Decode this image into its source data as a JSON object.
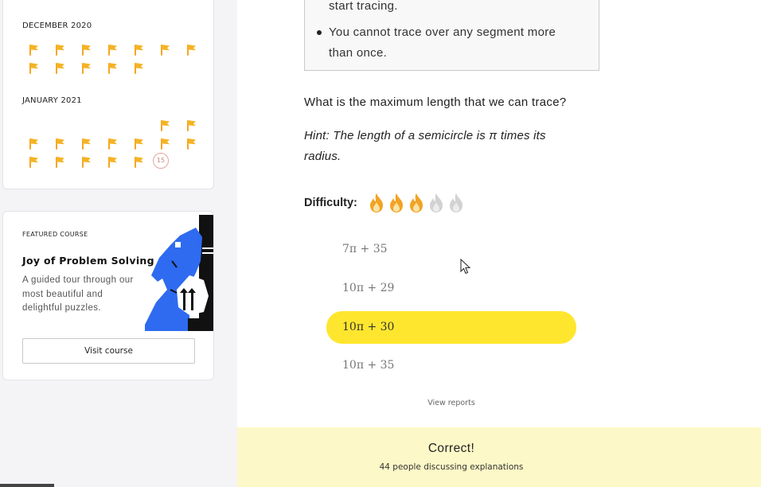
{
  "streaks": {
    "months": [
      {
        "label": "DECEMBER 2020"
      },
      {
        "label": "JANUARY 2021"
      }
    ],
    "today_day": "15",
    "flag_color": "#f5b324"
  },
  "featured_course": {
    "label": "FEATURED COURSE",
    "title": "Joy of Problem Solving",
    "description": "A guided tour through our most beautiful and delightful puzzles.",
    "button_label": "Visit course",
    "art_icon": "chess-knight-art"
  },
  "problem": {
    "rules": [
      "start tracing.",
      "You cannot trace over any segment more",
      "than once."
    ],
    "question": "What is the maximum length that we can trace?",
    "hint": "Hint: The length of a semicircle is π times its radius.",
    "difficulty_label": "Difficulty:",
    "difficulty_level": 3,
    "difficulty_max": 5,
    "options": [
      {
        "label": "7π + 35",
        "selected": false
      },
      {
        "label": "10π + 29",
        "selected": false
      },
      {
        "label": "10π + 30",
        "selected": true
      },
      {
        "label": "10π + 35",
        "selected": false
      }
    ],
    "view_reports": "View reports",
    "accent_color": "#ffe62e"
  },
  "feedback": {
    "status": "Correct!",
    "discussion": "44 people discussing explanations",
    "background": "#fdf8c7"
  }
}
